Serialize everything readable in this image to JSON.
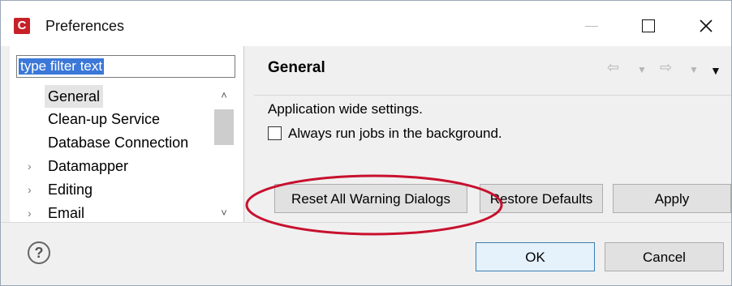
{
  "window": {
    "title": "Preferences",
    "app_icon": "C"
  },
  "filter": {
    "text": "type filter text"
  },
  "tree": {
    "items": [
      {
        "label": "General",
        "selected": true,
        "expandable": false
      },
      {
        "label": "Clean-up Service",
        "selected": false,
        "expandable": false
      },
      {
        "label": "Database Connection",
        "selected": false,
        "expandable": false
      },
      {
        "label": "Datamapper",
        "selected": false,
        "expandable": true
      },
      {
        "label": "Editing",
        "selected": false,
        "expandable": true
      },
      {
        "label": "Email",
        "selected": false,
        "expandable": true
      }
    ]
  },
  "page": {
    "title": "General",
    "description": "Application wide settings.",
    "checkbox_label": "Always run jobs in the background.",
    "checkbox_checked": false
  },
  "buttons": {
    "reset_warnings": "Reset All Warning Dialogs",
    "restore_defaults": "Restore Defaults",
    "apply": "Apply",
    "ok": "OK",
    "cancel": "Cancel"
  },
  "help_icon": "?",
  "colors": {
    "app_icon": "#c72128",
    "filter_selection": "#3b78d8",
    "annotation_ellipse": "#c8102e"
  }
}
